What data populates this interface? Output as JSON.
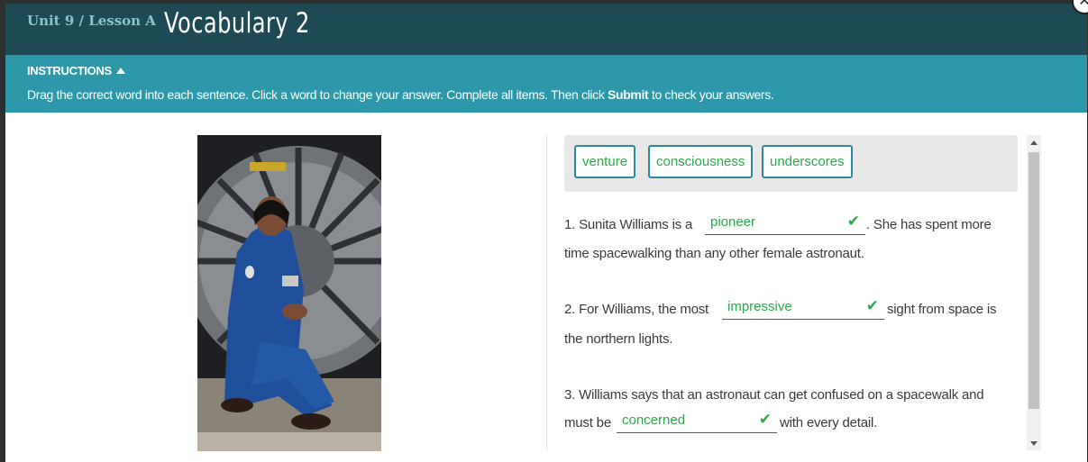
{
  "header": {
    "breadcrumb": "Unit 9 / Lesson A",
    "title": "Vocabulary 2",
    "close_icon": "close-icon"
  },
  "instructions": {
    "label": "INSTRUCTIONS",
    "text_before": "Drag the correct word into each sentence. Click a word to change your answer. Complete all items. Then click ",
    "text_bold": "Submit",
    "text_after": " to check your answers."
  },
  "word_bank": [
    "venture",
    "consciousness",
    "underscores"
  ],
  "questions": [
    {
      "line1_before": "1.  Sunita Williams is a",
      "answer": "pioneer",
      "line1_after": ". She has spent more",
      "line2": "time spacewalking than any other female astronaut."
    },
    {
      "line1_before": "2. For Williams, the most",
      "answer": "impressive",
      "line1_after": "sight from space is",
      "line2": "the northern lights."
    },
    {
      "line1": "3. Williams says that an astronaut can get confused on a spacewalk and",
      "line2_before": "must be",
      "answer": "concerned",
      "line2_after": "with every detail."
    }
  ],
  "check_mark": "✔",
  "colors": {
    "header_bg": "#1e4a55",
    "instructions_bg": "#2c98aa",
    "correct_green": "#2aa84a",
    "chip_border": "#2a8a99"
  }
}
